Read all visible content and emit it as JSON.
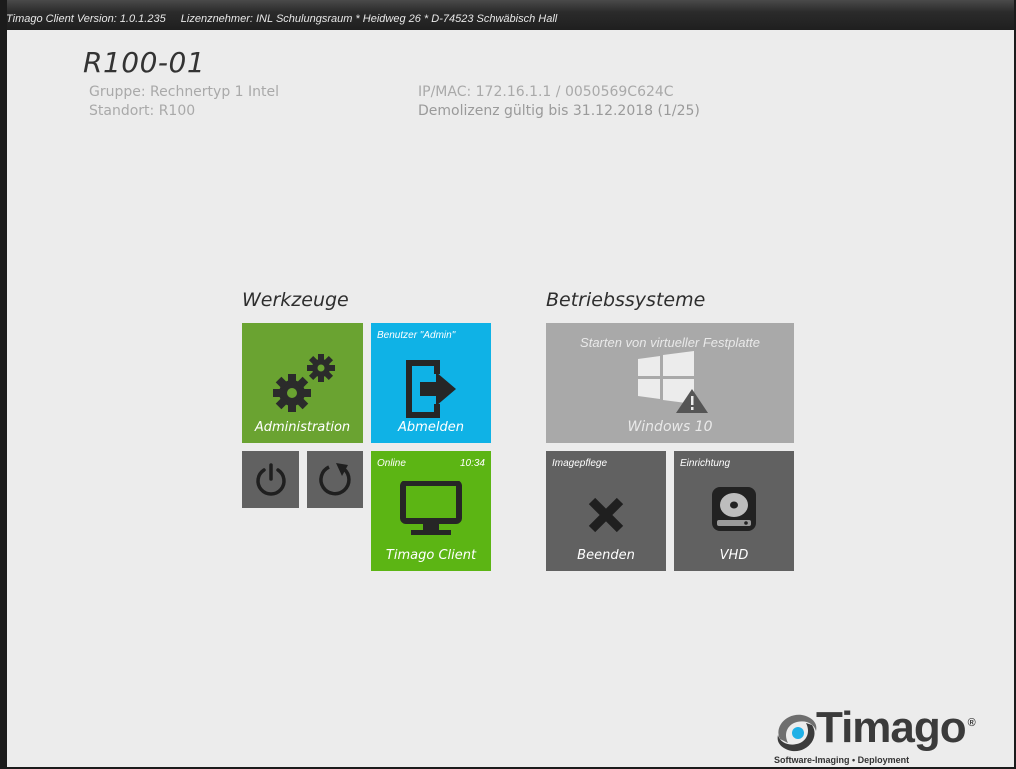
{
  "titlebar": {
    "version": "Timago Client Version: 1.0.1.235",
    "licensee": "Lizenznehmer: INL Schulungsraum * Heidweg 26 * D-74523 Schwäbisch Hall"
  },
  "host": {
    "name": "R100-01",
    "group": "Gruppe: Rechnertyp 1 Intel",
    "location": "Standort: R100",
    "ipmac": "IP/MAC: 172.16.1.1 / 0050569C624C",
    "license": "Demolizenz gültig bis 31.12.2018 (1/25)"
  },
  "sections": {
    "tools": "Werkzeuge",
    "os": "Betriebssysteme"
  },
  "tiles": {
    "admin": {
      "label": "Administration",
      "icon": "gears-icon",
      "color": "#6aa331"
    },
    "logout": {
      "top": "Benutzer \"Admin\"",
      "label": "Abmelden",
      "icon": "logout-icon",
      "color": "#0fb2e6"
    },
    "power": {
      "icon": "power-icon",
      "color": "#616161"
    },
    "restart": {
      "icon": "restart-icon",
      "color": "#616161"
    },
    "client": {
      "top_left": "Online",
      "top_right": "10:34",
      "label": "Timago Client",
      "icon": "monitor-icon",
      "color": "#5cb514"
    },
    "windows": {
      "top": "Starten von virtueller Festplatte",
      "label": "Windows 10",
      "icon": "windows-warning-icon",
      "color": "#a9a9a9"
    },
    "quit": {
      "top": "Imagepflege",
      "label": "Beenden",
      "icon": "close-x-icon",
      "color": "#616161"
    },
    "vhd": {
      "top": "Einrichtung",
      "label": "VHD",
      "icon": "hard-disk-icon",
      "color": "#616161"
    }
  },
  "logo": {
    "text": "Timago",
    "tagline": "Software-Imaging • Deployment"
  }
}
